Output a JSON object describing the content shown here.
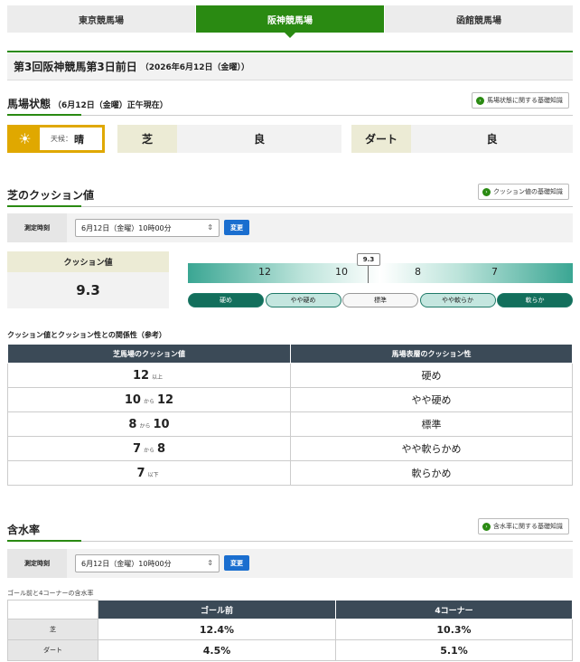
{
  "tabs": [
    {
      "label": "東京競馬場",
      "active": false
    },
    {
      "label": "阪神競馬場",
      "active": true
    },
    {
      "label": "函館競馬場",
      "active": false
    }
  ],
  "race": {
    "title": "第3回阪神競馬第3日前日",
    "date": "（2026年6月12日（金曜））"
  },
  "track": {
    "heading": "馬場状態",
    "sub": "（6月12日（金曜）正午現在）",
    "help": "馬場状態に関する基礎知識",
    "weather_label": "天候：",
    "weather_value": "晴",
    "turf_label": "芝",
    "turf_value": "良",
    "dirt_label": "ダート",
    "dirt_value": "良"
  },
  "cushion": {
    "heading": "芝のクッション値",
    "help": "クッション値の基礎知識",
    "measure_label": "測定時刻",
    "select_value": "6月12日（金曜）10時00分",
    "change_label": "変更",
    "value_label": "クッション値",
    "value": "9.3",
    "gauge_value": 9.3,
    "ticks": [
      "12",
      "10",
      "8",
      "7"
    ],
    "pills": [
      "硬め",
      "やや硬め",
      "標準",
      "やや軟らか",
      "軟らか"
    ]
  },
  "relation": {
    "title": "クッション値とクッション性との関係性（参考）",
    "headers": [
      "芝馬場のクッション値",
      "馬場表層のクッション性"
    ],
    "rows": [
      {
        "a": "12",
        "mid": "以上",
        "b": "",
        "desc": "硬め"
      },
      {
        "a": "10",
        "mid": "から",
        "b": "12",
        "desc": "やや硬め"
      },
      {
        "a": "8",
        "mid": "から",
        "b": "10",
        "desc": "標準"
      },
      {
        "a": "7",
        "mid": "から",
        "b": "8",
        "desc": "やや軟らかめ"
      },
      {
        "a": "7",
        "mid": "以下",
        "b": "",
        "desc": "軟らかめ"
      }
    ]
  },
  "moisture": {
    "heading": "含水率",
    "help": "含水率に関する基礎知識",
    "measure_label": "測定時刻",
    "select_value": "6月12日（金曜）10時00分",
    "change_label": "変更",
    "subtitle": "ゴール前と4コーナーの含水率",
    "headers": [
      "ゴール前",
      "4コーナー"
    ],
    "rows": [
      {
        "label": "芝",
        "goal": "12.4%",
        "corner": "10.3%"
      },
      {
        "label": "ダート",
        "goal": "4.5%",
        "corner": "5.1%"
      }
    ]
  },
  "colors": {
    "accent": "#2a8a12",
    "weather": "#e0a800",
    "button": "#1a6ecf",
    "table_header": "#3b4a57"
  }
}
